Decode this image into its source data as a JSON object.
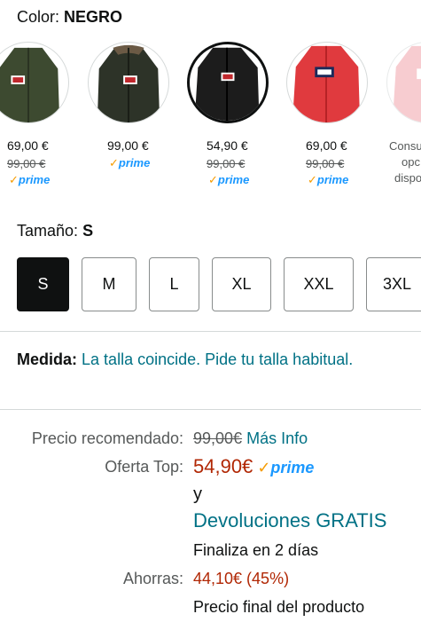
{
  "color": {
    "label": "Color:",
    "value": "NEGRO"
  },
  "swatches": [
    {
      "name": "Verde",
      "price": "69,00 €",
      "list_price": "99,00 €",
      "prime": "prime",
      "shirt_color": "#3d4a30",
      "selected": false
    },
    {
      "name": "Verde oscuro",
      "price": "99,00 €",
      "list_price": "",
      "prime": "prime",
      "shirt_color": "#2d3328",
      "selected": false
    },
    {
      "name": "Negro",
      "price": "54,90 €",
      "list_price": "99,00 €",
      "prime": "prime",
      "shirt_color": "#1c1c1c",
      "selected": true
    },
    {
      "name": "Rojo",
      "price": "69,00 €",
      "list_price": "99,00 €",
      "prime": "prime",
      "shirt_color": "#e03a3e",
      "selected": false
    },
    {
      "name": "Rosa",
      "other_lines": [
        "Consu",
        "opc",
        "dispo"
      ],
      "shirt_color": "#f2a3ab",
      "selected": false
    }
  ],
  "size": {
    "label": "Tamaño:",
    "value": "S",
    "options": [
      "S",
      "M",
      "L",
      "XL",
      "XXL",
      "3XL"
    ]
  },
  "fit": {
    "label": "Medida:",
    "text": "La talla coincide. Pide tu talla habitual."
  },
  "pricing": {
    "rec_label": "Precio recomendado:",
    "rec_price": "99,00€",
    "rec_link": "Más Info",
    "deal_label": "Oferta Top:",
    "deal_price": "54,90€",
    "prime": "prime",
    "and": "y",
    "returns": "Devoluciones GRATIS",
    "ends": "Finaliza en 2 días",
    "save_label": "Ahorras:",
    "save_value": "44,10€ (45%)",
    "final": "Precio final del producto"
  },
  "colors": {
    "prime_blue": "#1a98ff",
    "prime_check": "#f59b00",
    "link": "#007185",
    "deal_red": "#b12704"
  }
}
